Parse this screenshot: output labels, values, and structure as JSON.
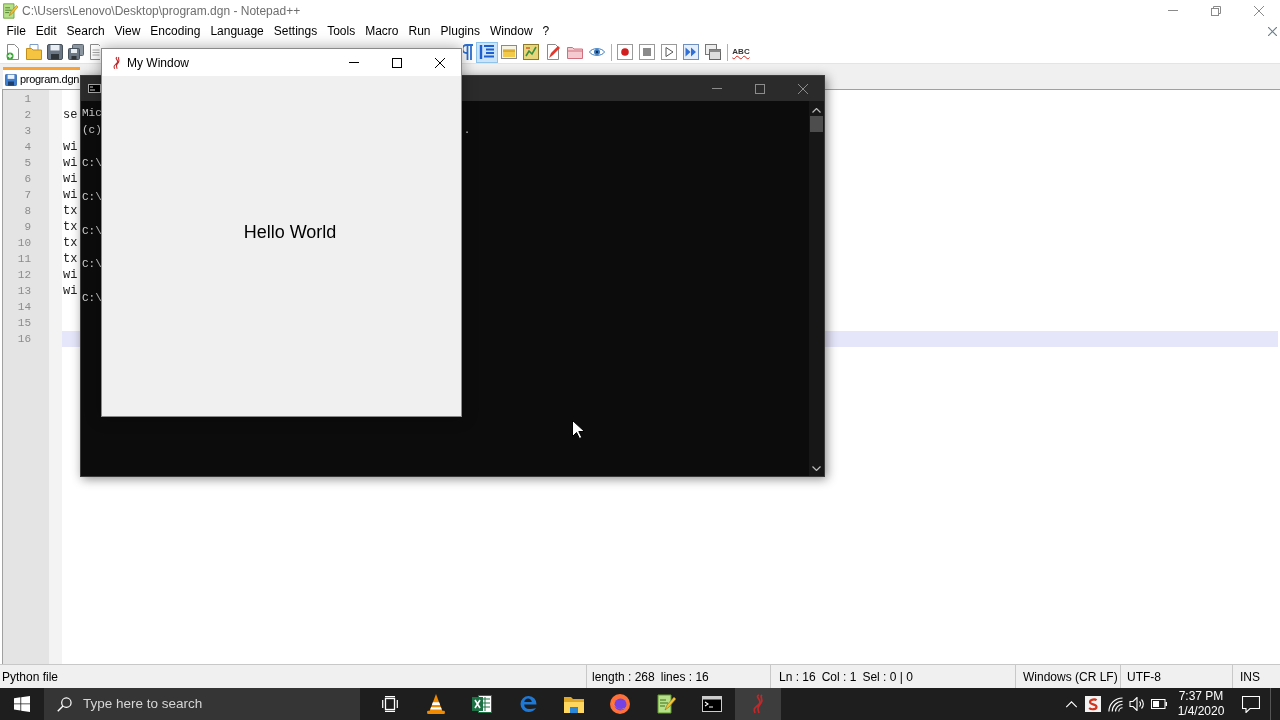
{
  "notepad": {
    "title": "C:\\Users\\Lenovo\\Desktop\\program.dgn - Notepad++",
    "menu": [
      "File",
      "Edit",
      "Search",
      "View",
      "Encoding",
      "Language",
      "Settings",
      "Tools",
      "Macro",
      "Run",
      "Plugins",
      "Window",
      "?"
    ],
    "toolbar": [
      [
        {
          "kind": "new"
        },
        {
          "kind": "open"
        },
        {
          "kind": "save"
        },
        {
          "kind": "saveall"
        },
        {
          "kind": "page"
        }
      ],
      [
        {
          "kind": "pilcrow",
          "pressed": false
        },
        {
          "kind": "indent",
          "pressed": true
        },
        {
          "kind": "panel",
          "pressed": false
        },
        {
          "kind": "chart",
          "pressed": false
        },
        {
          "kind": "docpen",
          "pressed": false
        },
        {
          "kind": "folder",
          "pressed": false
        },
        {
          "kind": "eye",
          "pressed": false
        },
        {
          "kind": "separator"
        },
        {
          "kind": "record"
        },
        {
          "kind": "stop"
        },
        {
          "kind": "play"
        },
        {
          "kind": "fastforward"
        },
        {
          "kind": "windows"
        },
        {
          "kind": "separator"
        },
        {
          "kind": "spell",
          "label": "ABC"
        }
      ]
    ],
    "tabs": [
      {
        "label": "program.dgn",
        "selected": true
      }
    ],
    "editor": {
      "lines": [
        {
          "number": "1",
          "current": false
        },
        {
          "number": "2",
          "text": "se",
          "current": false
        },
        {
          "number": "3",
          "current": false
        },
        {
          "number": "4",
          "text": "wi",
          "current": false
        },
        {
          "number": "5",
          "text": "wi",
          "current": false
        },
        {
          "number": "6",
          "text": "wi",
          "current": false
        },
        {
          "number": "7",
          "text": "wi",
          "current": false
        },
        {
          "number": "8",
          "text": "tx",
          "current": false
        },
        {
          "number": "9",
          "text": "tx",
          "current": false
        },
        {
          "number": "10",
          "text": "tx",
          "current": false
        },
        {
          "number": "11",
          "text": "tx",
          "current": false
        },
        {
          "number": "12",
          "text": "wi",
          "current": false
        },
        {
          "number": "13",
          "text": "wi",
          "current": false
        },
        {
          "number": "14",
          "current": false
        },
        {
          "number": "15",
          "current": false
        },
        {
          "number": "16",
          "current": true
        }
      ]
    },
    "status_bar": [
      [
        "Python file"
      ],
      [
        "length : 268",
        "lines : 16"
      ],
      [
        "Ln : 16",
        "Col : 1",
        "Sel : 0 | 0"
      ],
      [
        "Windows (CR LF)"
      ],
      [
        "UTF-8"
      ],
      [
        "INS"
      ]
    ]
  },
  "console": {
    "lines": [
      {
        "kind": "banner",
        "text": "Mic"
      },
      {
        "kind": "banner",
        "text": "(c)",
        "tail": "."
      },
      {
        "kind": "prompt",
        "text": "C:\\"
      },
      {
        "kind": "prompt",
        "text": "C:\\"
      },
      {
        "kind": "prompt",
        "text": "C:\\"
      },
      {
        "kind": "prompt",
        "text": "C:\\"
      },
      {
        "kind": "prompt",
        "text": "C:\\"
      }
    ]
  },
  "app_window": {
    "title": "My Window",
    "label": "Hello World"
  },
  "taskbar": {
    "search": {
      "placeholder": "Type here to search"
    },
    "apps": [
      {
        "kind": "taskview",
        "active": false
      },
      {
        "kind": "vlc",
        "active": false
      },
      {
        "kind": "excel",
        "active": false
      },
      {
        "kind": "edge",
        "active": false
      },
      {
        "kind": "explorer",
        "active": false
      },
      {
        "kind": "firefox",
        "active": false
      },
      {
        "kind": "notepad",
        "active": false
      },
      {
        "kind": "cmd",
        "active": false
      },
      {
        "kind": "tk",
        "active": true
      }
    ],
    "clock": {
      "time": "7:37 PM",
      "date": "1/4/2020"
    }
  }
}
